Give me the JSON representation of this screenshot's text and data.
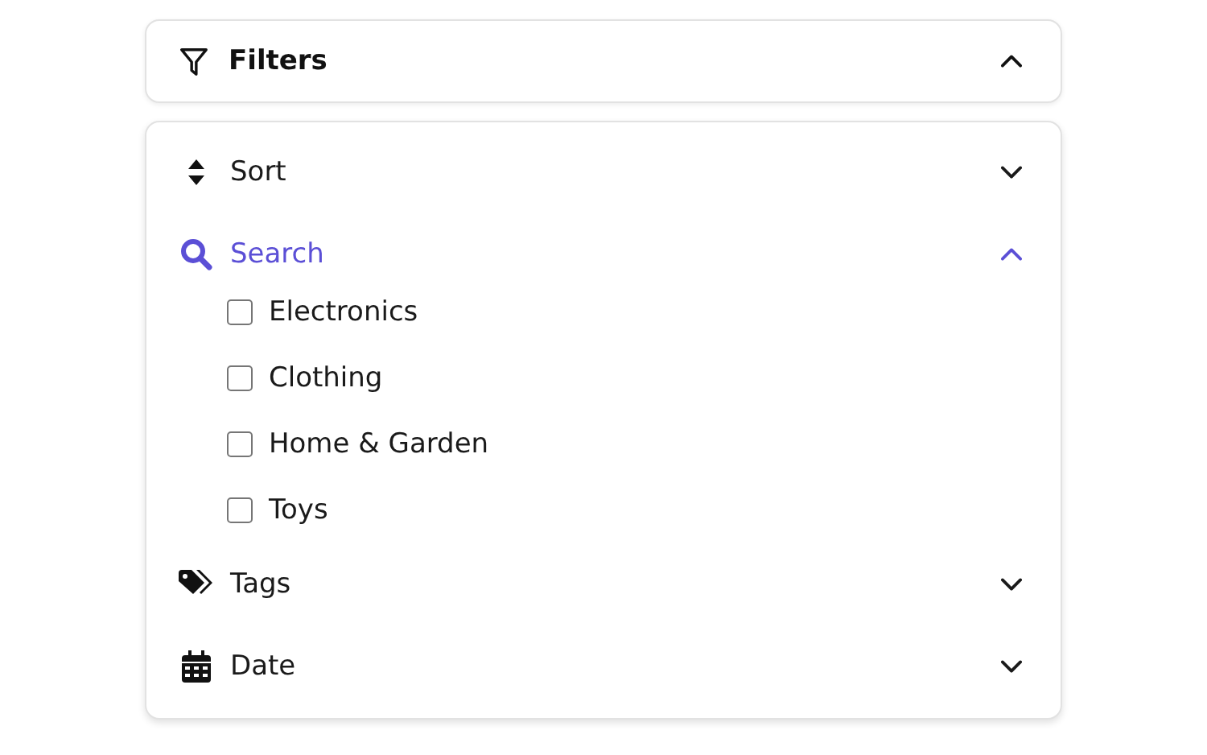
{
  "header": {
    "title": "Filters",
    "expanded": true
  },
  "sections": [
    {
      "kind": "sort",
      "label": "Sort",
      "expanded": false
    },
    {
      "kind": "search",
      "label": "Search",
      "expanded": true,
      "options": [
        {
          "label": "Electronics",
          "checked": false
        },
        {
          "label": "Clothing",
          "checked": false
        },
        {
          "label": "Home & Garden",
          "checked": false
        },
        {
          "label": "Toys",
          "checked": false
        }
      ]
    },
    {
      "kind": "tags",
      "label": "Tags",
      "expanded": false
    },
    {
      "kind": "date",
      "label": "Date",
      "expanded": false
    }
  ]
}
